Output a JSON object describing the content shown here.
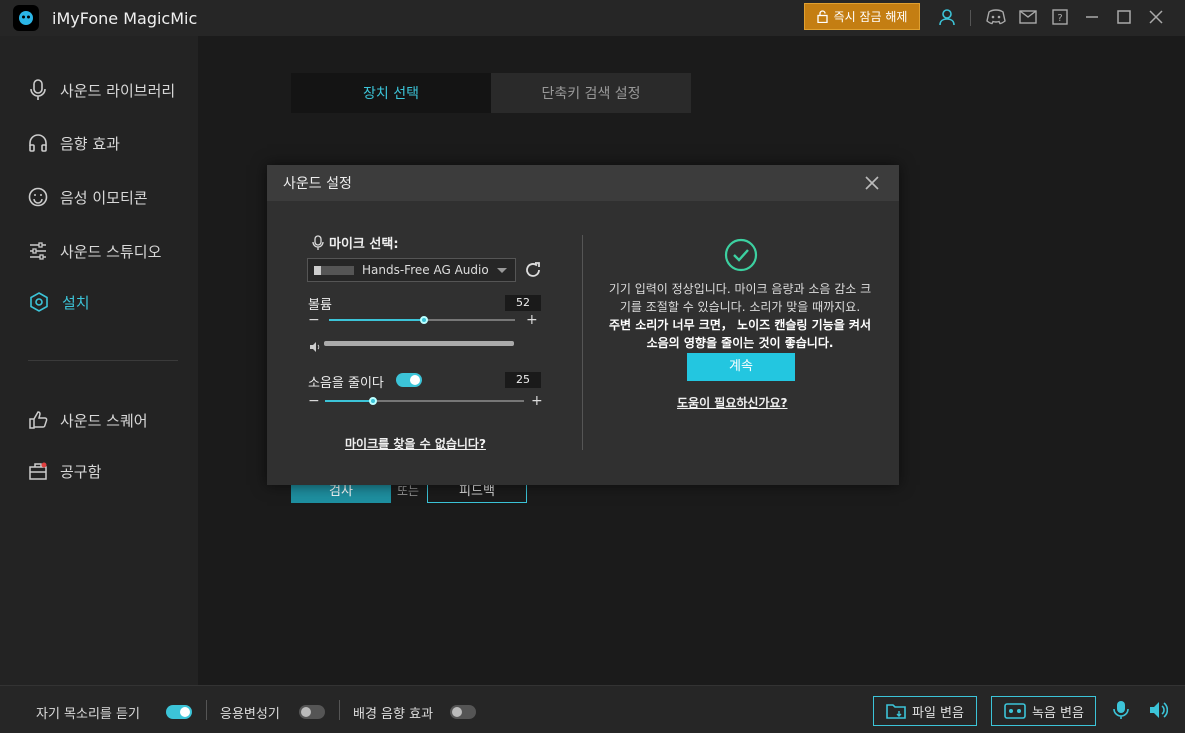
{
  "app": {
    "title": "iMyFone MagicMic",
    "unlock_label": "즉시 잠금 해제"
  },
  "sidebar": {
    "items": [
      {
        "label": "사운드 라이브러리",
        "icon": "microphone-icon"
      },
      {
        "label": "음향 효과",
        "icon": "headphones-icon"
      },
      {
        "label": "음성 이모티콘",
        "icon": "smiley-icon"
      },
      {
        "label": "사운드 스튜디오",
        "icon": "sliders-icon"
      },
      {
        "label": "설치",
        "icon": "settings-icon",
        "active": true
      },
      {
        "label": "사운드 스퀘어",
        "icon": "thumbs-up-icon"
      },
      {
        "label": "공구함",
        "icon": "toolbox-icon"
      }
    ]
  },
  "main": {
    "tabs": [
      {
        "label": "장치 선택",
        "active": true
      },
      {
        "label": "단축키 검색 설정",
        "active": false
      }
    ],
    "check_label": "검사",
    "or_label": "또는",
    "feedback_label": "피드백"
  },
  "modal": {
    "title": "사운드 설정",
    "mic_label": "마이크 선택:",
    "device_value": "Hands-Free AG Audio",
    "volume_label": "볼륨",
    "volume_value": 52,
    "noise_label": "소음을 줄이다",
    "noise_value": 25,
    "noise_enabled": true,
    "minus": "−",
    "plus": "+",
    "mic_not_found_link": "마이크를 찾을 수 없습니다?",
    "info_line1": "기기 입력이 정상입니다. 마이크 음량과 소음 감소 크기를 조절할 수 있습니다. 소리가 맞을 때까지요.",
    "info_line2": "주변 소리가 너무 크면， 노이즈 캔슬링 기능을 켜서 소음의 영향을 줄이는 것이 좋습니다.",
    "continue_label": "계속",
    "help_link": "도움이 필요하신가요?"
  },
  "bottombar": {
    "hear_self_label": "자기 목소리를 듣기",
    "hear_self_on": true,
    "app_changer_label": "응용변성기",
    "app_changer_on": false,
    "bg_effect_label": "배경 음향 효과",
    "bg_effect_on": false,
    "file_change_label": "파일 변음",
    "record_change_label": "녹음 변음"
  },
  "colors": {
    "accent": "#3cc4d8",
    "unlock": "#c47e12",
    "continue": "#23c6e0"
  }
}
